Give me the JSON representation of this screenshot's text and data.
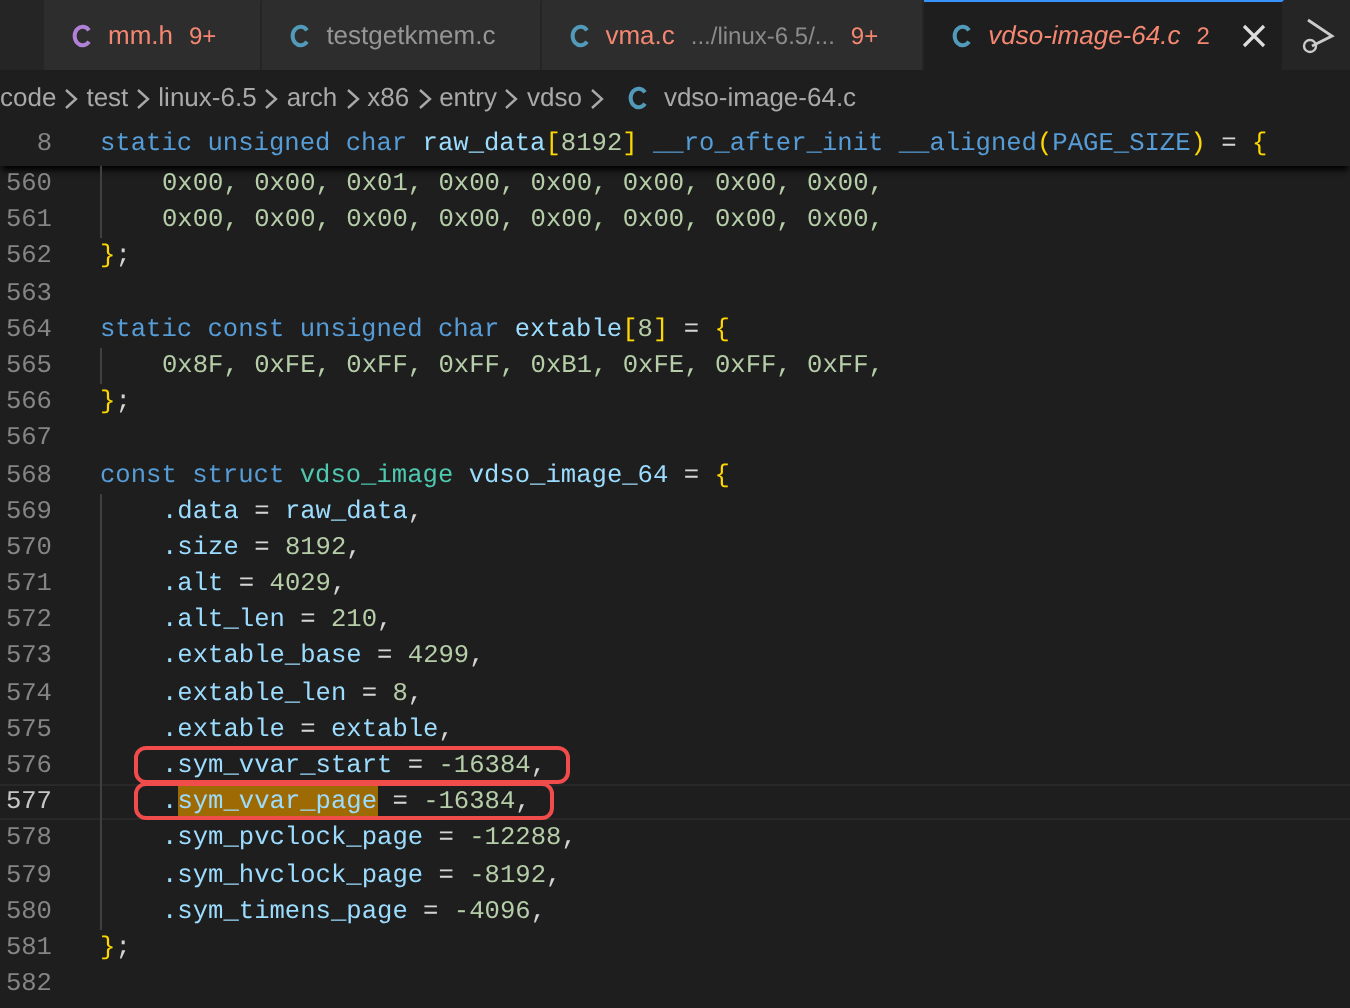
{
  "tabs": [
    {
      "label": "mm.h",
      "kind": "header",
      "badge": "9+",
      "errors": true,
      "preview": false,
      "selected": false
    },
    {
      "label": "testgetkmem.c",
      "kind": "source",
      "errors": false,
      "preview": false,
      "selected": false
    },
    {
      "label": "vma.c",
      "kind": "source",
      "path": ".../linux-6.5/...",
      "badge": "9+",
      "errors": true,
      "preview": false,
      "selected": false
    },
    {
      "label": "vdso-image-64.c",
      "kind": "source",
      "badge": "2",
      "errors": true,
      "preview": true,
      "selected": true
    }
  ],
  "breadcrumb": [
    {
      "label": "code",
      "kind": "folder"
    },
    {
      "label": "test",
      "kind": "folder"
    },
    {
      "label": "linux-6.5",
      "kind": "folder"
    },
    {
      "label": "arch",
      "kind": "folder"
    },
    {
      "label": "x86",
      "kind": "folder"
    },
    {
      "label": "entry",
      "kind": "folder"
    },
    {
      "label": "vdso",
      "kind": "folder"
    },
    {
      "label": "vdso-image-64.c",
      "kind": "file"
    }
  ],
  "sticky_line": {
    "number": "8",
    "tokens": [
      {
        "text": "static unsigned char ",
        "kind": "kw"
      },
      {
        "text": "raw_data",
        "kind": "id"
      },
      {
        "text": "[",
        "kind": "brace"
      },
      {
        "text": "8192",
        "kind": "num"
      },
      {
        "text": "]",
        "kind": "brace"
      },
      {
        "text": " __ro_after_init __aligned",
        "kind": "kw"
      },
      {
        "text": "(",
        "kind": "brace"
      },
      {
        "text": "PAGE_SIZE",
        "kind": "kw"
      },
      {
        "text": ")",
        "kind": "brace"
      },
      {
        "text": " = ",
        "kind": "p"
      },
      {
        "text": "{",
        "kind": "brace"
      }
    ]
  },
  "lines": [
    {
      "number": "560",
      "indent": true,
      "tokens": [
        {
          "text": "0x00, 0x00, 0x01, 0x00, 0x00, 0x00, 0x00, 0x00,",
          "kind": "num"
        }
      ]
    },
    {
      "number": "561",
      "indent": true,
      "tokens": [
        {
          "text": "0x00, 0x00, 0x00, 0x00, 0x00, 0x00, 0x00, 0x00,",
          "kind": "num"
        }
      ]
    },
    {
      "number": "562",
      "tokens": [
        {
          "text": "}",
          "kind": "brace"
        },
        {
          "text": ";",
          "kind": "p"
        }
      ]
    },
    {
      "number": "563"
    },
    {
      "number": "564",
      "tokens": [
        {
          "text": "static const unsigned char ",
          "kind": "kw"
        },
        {
          "text": "extable",
          "kind": "id"
        },
        {
          "text": "[",
          "kind": "brace"
        },
        {
          "text": "8",
          "kind": "num"
        },
        {
          "text": "]",
          "kind": "brace"
        },
        {
          "text": " = ",
          "kind": "p"
        },
        {
          "text": "{",
          "kind": "brace"
        }
      ]
    },
    {
      "number": "565",
      "indent": true,
      "tokens": [
        {
          "text": "0x8F, 0xFE, 0xFF, 0xFF, 0xB1, 0xFE, 0xFF, 0xFF,",
          "kind": "num"
        }
      ]
    },
    {
      "number": "566",
      "tokens": [
        {
          "text": "}",
          "kind": "brace"
        },
        {
          "text": ";",
          "kind": "p"
        }
      ]
    },
    {
      "number": "567"
    },
    {
      "number": "568",
      "tokens": [
        {
          "text": "const struct ",
          "kind": "kw"
        },
        {
          "text": "vdso_image ",
          "kind": "type"
        },
        {
          "text": "vdso_image_64",
          "kind": "id"
        },
        {
          "text": " = ",
          "kind": "p"
        },
        {
          "text": "{",
          "kind": "brace"
        }
      ]
    },
    {
      "number": "569",
      "indent": true,
      "tokens": [
        {
          "text": ".data",
          "kind": "id"
        },
        {
          "text": " = ",
          "kind": "p"
        },
        {
          "text": "raw_data",
          "kind": "id"
        },
        {
          "text": ",",
          "kind": "p"
        }
      ]
    },
    {
      "number": "570",
      "indent": true,
      "tokens": [
        {
          "text": ".size",
          "kind": "id"
        },
        {
          "text": " = ",
          "kind": "p"
        },
        {
          "text": "8192",
          "kind": "num"
        },
        {
          "text": ",",
          "kind": "p"
        }
      ]
    },
    {
      "number": "571",
      "indent": true,
      "tokens": [
        {
          "text": ".alt",
          "kind": "id"
        },
        {
          "text": " = ",
          "kind": "p"
        },
        {
          "text": "4029",
          "kind": "num"
        },
        {
          "text": ",",
          "kind": "p"
        }
      ]
    },
    {
      "number": "572",
      "indent": true,
      "tokens": [
        {
          "text": ".alt_len",
          "kind": "id"
        },
        {
          "text": " = ",
          "kind": "p"
        },
        {
          "text": "210",
          "kind": "num"
        },
        {
          "text": ",",
          "kind": "p"
        }
      ]
    },
    {
      "number": "573",
      "indent": true,
      "tokens": [
        {
          "text": ".extable_base",
          "kind": "id"
        },
        {
          "text": " = ",
          "kind": "p"
        },
        {
          "text": "4299",
          "kind": "num"
        },
        {
          "text": ",",
          "kind": "p"
        }
      ]
    },
    {
      "number": "574",
      "indent": true,
      "tokens": [
        {
          "text": ".extable_len",
          "kind": "id"
        },
        {
          "text": " = ",
          "kind": "p"
        },
        {
          "text": "8",
          "kind": "num"
        },
        {
          "text": ",",
          "kind": "p"
        }
      ]
    },
    {
      "number": "575",
      "indent": true,
      "tokens": [
        {
          "text": ".extable",
          "kind": "id"
        },
        {
          "text": " = ",
          "kind": "p"
        },
        {
          "text": "extable",
          "kind": "id"
        },
        {
          "text": ",",
          "kind": "p"
        }
      ]
    },
    {
      "number": "576",
      "indent": true,
      "boxed": true,
      "tokens": [
        {
          "text": ".sym_vvar_start",
          "kind": "id"
        },
        {
          "text": " = ",
          "kind": "p"
        },
        {
          "text": "-16384",
          "kind": "num"
        },
        {
          "text": ",",
          "kind": "p"
        }
      ]
    },
    {
      "number": "577",
      "indent": true,
      "boxed": true,
      "current": true,
      "tokens": [
        {
          "text": ".",
          "kind": "id"
        },
        {
          "text": "sym_vvar_page",
          "kind": "match"
        },
        {
          "text": " = ",
          "kind": "p"
        },
        {
          "text": "-16384",
          "kind": "num"
        },
        {
          "text": ",",
          "kind": "p"
        }
      ]
    },
    {
      "number": "578",
      "indent": true,
      "tokens": [
        {
          "text": ".sym_pvclock_page",
          "kind": "id"
        },
        {
          "text": " = ",
          "kind": "p"
        },
        {
          "text": "-12288",
          "kind": "num"
        },
        {
          "text": ",",
          "kind": "p"
        }
      ]
    },
    {
      "number": "579",
      "indent": true,
      "tokens": [
        {
          "text": ".sym_hvclock_page",
          "kind": "id"
        },
        {
          "text": " = ",
          "kind": "p"
        },
        {
          "text": "-8192",
          "kind": "num"
        },
        {
          "text": ",",
          "kind": "p"
        }
      ]
    },
    {
      "number": "580",
      "indent": true,
      "tokens": [
        {
          "text": ".sym_timens_page",
          "kind": "id"
        },
        {
          "text": " = ",
          "kind": "p"
        },
        {
          "text": "-4096",
          "kind": "num"
        },
        {
          "text": ",",
          "kind": "p"
        }
      ]
    },
    {
      "number": "581",
      "tokens": [
        {
          "text": "}",
          "kind": "brace"
        },
        {
          "text": ";",
          "kind": "p"
        }
      ]
    },
    {
      "number": "582"
    }
  ]
}
